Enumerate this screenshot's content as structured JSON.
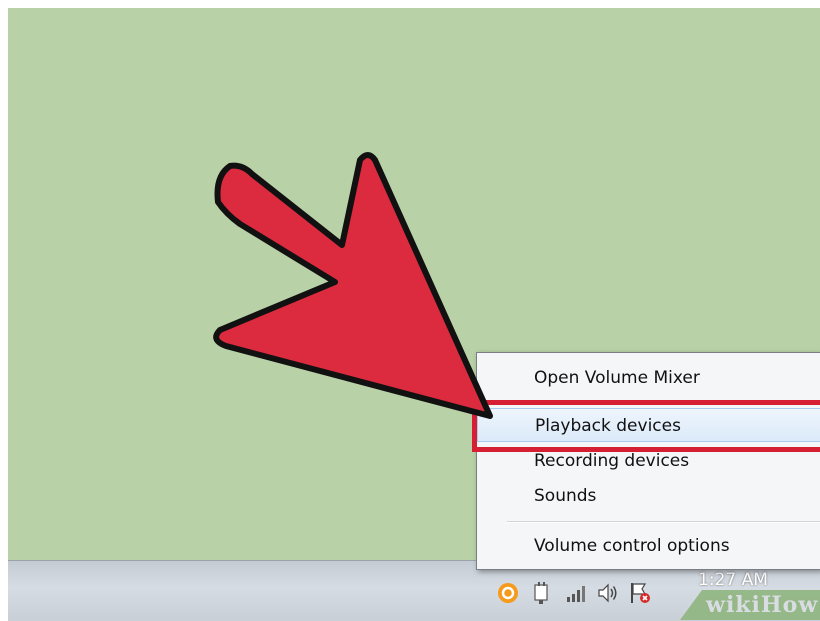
{
  "context_menu": {
    "items": [
      {
        "label": "Open Volume Mixer"
      },
      {
        "label": "Playback devices"
      },
      {
        "label": "Recording devices"
      },
      {
        "label": "Sounds"
      },
      {
        "label": "Volume control options"
      }
    ]
  },
  "taskbar": {
    "clock_time": "1:27 AM",
    "tray_icons": [
      "app-circle-icon",
      "power-plug-icon",
      "signal-bars-icon",
      "speaker-icon",
      "action-center-flag-icon"
    ]
  },
  "watermark": {
    "text": "wikiHow"
  },
  "colors": {
    "desktop": "#b9d1a6",
    "arrow": "#dc2b3f",
    "highlight": "#d61f33"
  }
}
